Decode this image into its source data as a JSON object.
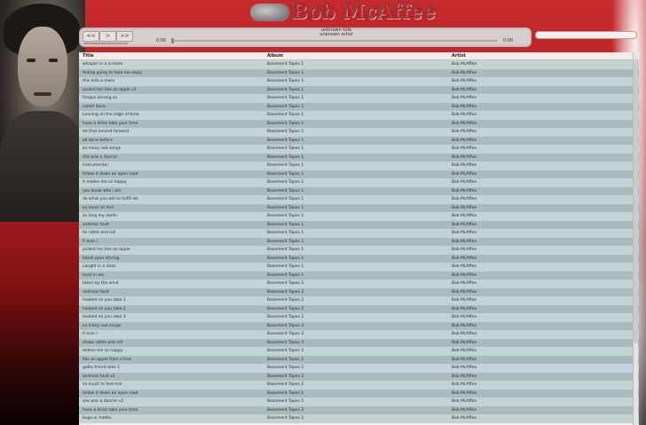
{
  "header": {
    "logo_text": "Bob McAffee"
  },
  "player": {
    "buttons": {
      "prev": "<<",
      "play": ">",
      "next": ">>"
    },
    "track_title": "unknown title",
    "track_artist": "unknown artist",
    "current_time": "0:00",
    "total_time": "0:00"
  },
  "search": {
    "value": ""
  },
  "playlist": {
    "columns": {
      "title": "Title",
      "album": "Album",
      "artist": "Artist"
    },
    "rows": [
      {
        "title": "whisper in a scream",
        "album": "Basement Tapes 1",
        "artist": "Bob McAffee"
      },
      {
        "title": "fading going to take me away",
        "album": "Basement Tapes 1",
        "artist": "Bob McAffee"
      },
      {
        "title": "this kids a mess",
        "album": "Basement Tapes 1",
        "artist": "Bob McAffee"
      },
      {
        "title": "picked her like an apple v2",
        "album": "Basement Tapes 1",
        "artist": "Bob McAffee"
      },
      {
        "title": "fungus among us",
        "album": "Basement Tapes 1",
        "artist": "Bob McAffee"
      },
      {
        "title": "sailed done",
        "album": "Basement Tapes 1",
        "artist": "Bob McAffee"
      },
      {
        "title": "Leaning on the edge of time",
        "album": "Basement Tapes 1",
        "artist": "Bob McAffee"
      },
      {
        "title": "have a drink take your time",
        "album": "Basement Tapes 1",
        "artist": "Bob McAffee"
      },
      {
        "title": "let that lament forward",
        "album": "Basement Tapes 1",
        "artist": "Bob McAffee"
      },
      {
        "title": "all done before",
        "album": "Basement Tapes 1",
        "artist": "Bob McAffee"
      },
      {
        "title": "so many sad songs",
        "album": "Basement Tapes 1",
        "artist": "Bob McAffee"
      },
      {
        "title": "she was a dancer",
        "album": "Basement Tapes 1",
        "artist": "Bob McAffee"
      },
      {
        "title": "instrumental",
        "album": "Basement Tapes 1",
        "artist": "Bob McAffee"
      },
      {
        "title": "follow it down an open road",
        "album": "Basement Tapes 1",
        "artist": "Bob McAffee"
      },
      {
        "title": "it makes me so happy",
        "album": "Basement Tapes 1",
        "artist": "Bob McAffee"
      },
      {
        "title": "you know who i am",
        "album": "Basement Tapes 1",
        "artist": "Bob McAffee"
      },
      {
        "title": "do what you will to fulfill wh",
        "album": "Basement Tapes 1",
        "artist": "Bob McAffee"
      },
      {
        "title": "so much to feel",
        "album": "Basement Tapes 1",
        "artist": "Bob McAffee"
      },
      {
        "title": "so long my darlin",
        "album": "Basement Tapes 1",
        "artist": "Bob McAffee"
      },
      {
        "title": "andreas fault",
        "album": "Basement Tapes 1",
        "artist": "Bob McAffee"
      },
      {
        "title": "its rattle and roll",
        "album": "Basement Tapes 1",
        "artist": "Bob McAffee"
      },
      {
        "title": "if ever i",
        "album": "Basement Tapes 1",
        "artist": "Bob McAffee"
      },
      {
        "title": "picked her like an apple",
        "album": "Basement Tapes 1",
        "artist": "Bob McAffee"
      },
      {
        "title": "blank eyes staring",
        "album": "Basement Tapes 1",
        "artist": "Bob McAffee"
      },
      {
        "title": "caught in a daze",
        "album": "Basement Tapes 1",
        "artist": "Bob McAffee"
      },
      {
        "title": "trust in we",
        "album": "Basement Tapes 1",
        "artist": "Bob McAffee"
      },
      {
        "title": "taken by the wind",
        "album": "Basement Tapes 2",
        "artist": "Bob McAffee"
      },
      {
        "title": "andreas fault",
        "album": "Basement Tapes 2",
        "artist": "Bob McAffee"
      },
      {
        "title": "hooked on you take 1",
        "album": "Basement Tapes 2",
        "artist": "Bob McAffee"
      },
      {
        "title": "hooked on you take 2",
        "album": "Basement Tapes 2",
        "artist": "Bob McAffee"
      },
      {
        "title": "hooked on you take 3",
        "album": "Basement Tapes 2",
        "artist": "Bob McAffee"
      },
      {
        "title": "so many sad songs",
        "album": "Basement Tapes 3",
        "artist": "Bob McAffee"
      },
      {
        "title": "if ever i",
        "album": "Basement Tapes 2",
        "artist": "Bob McAffee"
      },
      {
        "title": "shake rattle and roll",
        "album": "Basement Tapes 3",
        "artist": "Bob McAffee"
      },
      {
        "title": "makes me so happy",
        "album": "Basement Tapes 2",
        "artist": "Bob McAffee"
      },
      {
        "title": "like an apple from a tree",
        "album": "Basement Tapes 2",
        "artist": "Bob McAffee"
      },
      {
        "title": "gotta friend take 1",
        "album": "Basement Tapes 2",
        "artist": "Bob McAffee"
      },
      {
        "title": "andreas fault v2",
        "album": "Basement Tapes 2",
        "artist": "Bob McAffee"
      },
      {
        "title": "so much to feel mix",
        "album": "Basement Tapes 2",
        "artist": "Bob McAffee"
      },
      {
        "title": "follow it down an open road",
        "album": "Basement Tapes 2",
        "artist": "Bob McAffee"
      },
      {
        "title": "she was a dancer v2",
        "album": "Basement Tapes 2",
        "artist": "Bob McAffee"
      },
      {
        "title": "have a drink take your time",
        "album": "Basement Tapes 2",
        "artist": "Bob McAffee"
      },
      {
        "title": "bugs or moths",
        "album": "Basement Tapes 2",
        "artist": "Bob McAffee"
      }
    ]
  }
}
